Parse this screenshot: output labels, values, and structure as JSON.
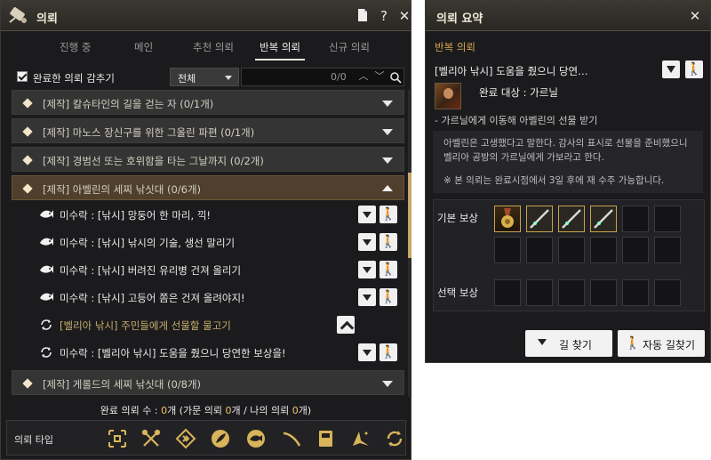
{
  "main_window": {
    "title": "의뢰",
    "tabs": [
      {
        "label": "진행 중"
      },
      {
        "label": "메인"
      },
      {
        "label": "추천 의뢰"
      },
      {
        "label": "반복 의뢰",
        "active": true
      },
      {
        "label": "신규 의뢰"
      }
    ],
    "filter": {
      "hide_completed_label": "완료한 의뢰 감추기",
      "hide_completed_checked": true,
      "category_select": "전체",
      "search_count": "0/0"
    },
    "categories": [
      {
        "label": "[제작] 칼슈타인의 길을 걷는 자 (0/1개)",
        "expanded": false
      },
      {
        "label": "[제작] 마노스 장신구를 위한 그올린 파편 (0/1개)",
        "expanded": false
      },
      {
        "label": "[제작] 경범선 또는 호위함을 타는 그날까지 (0/2개)",
        "expanded": false
      },
      {
        "label": "[제작] 아벨린의 세찌 낚싯대 (0/6개)",
        "expanded": true
      },
      {
        "label": "[제작] 게롤드의 세찌 낚싯대 (0/8개)",
        "expanded": false
      }
    ],
    "quests": [
      {
        "icon": "fishing-icon",
        "label": "미수락 : [낚시] 망둥어 한 마리, 끽!",
        "state": "available"
      },
      {
        "icon": "fishing-icon",
        "label": "미수락 : [낚시] 낚시의 기술, 생선 말리기",
        "state": "available"
      },
      {
        "icon": "fishing-icon",
        "label": "미수락 : [낚시] 버려진 유리병 건져 올리기",
        "state": "available"
      },
      {
        "icon": "fishing-icon",
        "label": "미수락 : [낚시] 고등어 쫌은 건져 올려야지!",
        "state": "available"
      },
      {
        "icon": "repeat-icon",
        "label": "[벨리아 낚시] 주민들에게 선물할 물고기",
        "state": "progress"
      },
      {
        "icon": "repeat-icon",
        "label": "미수락 : [벨리아 낚시] 도움을 줬으니 당연한 보상을!",
        "state": "available"
      }
    ],
    "summary": {
      "prefix": "완료 의뢰 수 : ",
      "count1": "0",
      "mid1": "개 (가문 의뢰 ",
      "count2": "0",
      "mid2": "개 / 나의 의뢰 ",
      "count3": "0",
      "suffix": "개)"
    },
    "type_bar": {
      "label": "의뢰 타입",
      "icons": [
        "combat-icon",
        "crafting-icon",
        "trade-icon",
        "gathering-icon",
        "fishing-icon",
        "hunting-icon",
        "book-icon",
        "special-icon",
        "repeat-icon"
      ]
    },
    "colors": {
      "accent": "#c8a569",
      "highlight": "#f2c36b",
      "open_category": "#4f3f2c"
    }
  },
  "summary_window": {
    "title": "의뢰 요약",
    "section": "반복 의뢰",
    "quest_title": "[벨리아 낚시] 도움을 줬으니 당연…",
    "target": "완료 대상 : 가르닐",
    "objective": "- 가르닐에게 이동해 아벨린의 선물 받기",
    "description": "아벨린은 고생했다고 말한다. 감사의 표시로 선물을 준비했으니 벨리아 공방의 가르닐에게 가보라고 한다.",
    "note": "※ 본 의뢰는 완료시점에서 3일 후에 재 수주 가능합니다.",
    "basic_reward_label": "기본 보상",
    "choice_reward_label": "선택 보상",
    "basic_rewards": [
      "medal-item",
      "fishing-rod-item",
      "fishing-rod-item",
      "fishing-rod-item",
      "",
      "",
      "",
      "",
      "",
      "",
      "",
      ""
    ],
    "choice_rewards": [
      "",
      "",
      "",
      "",
      "",
      ""
    ],
    "find_path_label": "길 찾기",
    "auto_path_label": "자동 길찾기"
  }
}
